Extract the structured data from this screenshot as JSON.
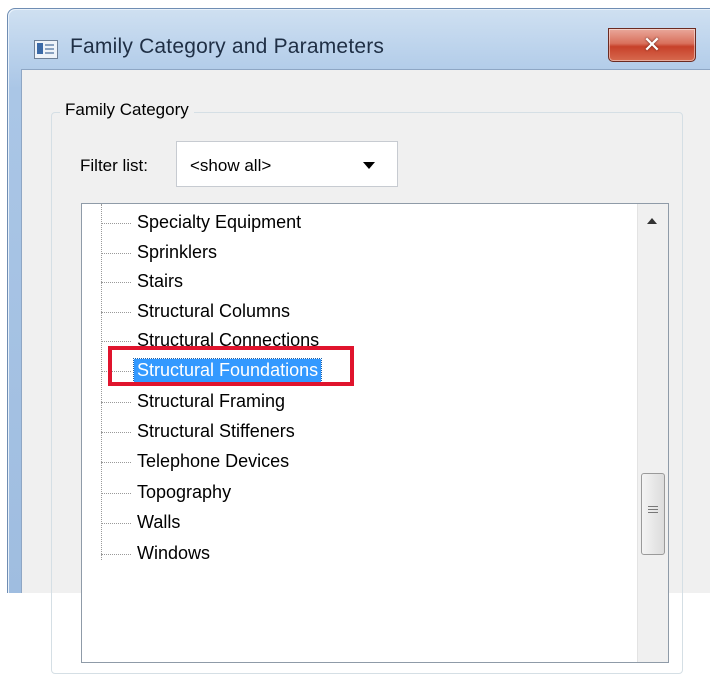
{
  "window": {
    "title": "Family Category and Parameters",
    "close_label": "✕"
  },
  "family_category": {
    "group_label": "Family Category",
    "filter": {
      "label": "Filter list:",
      "value": "<show all>"
    },
    "tree": {
      "items": [
        {
          "label": "Specialty Equipment",
          "selected": false
        },
        {
          "label": "Sprinklers",
          "selected": false
        },
        {
          "label": "Stairs",
          "selected": false
        },
        {
          "label": "Structural Columns",
          "selected": false
        },
        {
          "label": "Structural Connections",
          "selected": false
        },
        {
          "label": "Structural Foundations",
          "selected": true
        },
        {
          "label": "Structural Framing",
          "selected": false
        },
        {
          "label": "Structural Stiffeners",
          "selected": false
        },
        {
          "label": "Telephone Devices",
          "selected": false
        },
        {
          "label": "Topography",
          "selected": false
        },
        {
          "label": "Walls",
          "selected": false
        },
        {
          "label": "Windows",
          "selected": false
        }
      ]
    }
  },
  "icons": {
    "app": "family-dialog-icon",
    "close": "close-icon",
    "dropdown": "chevron-down-icon",
    "scroll_up": "scroll-up-arrow-icon",
    "thumb": "scroll-thumb-grip-icon"
  },
  "colors": {
    "selection": "#3399ff",
    "annotation": "#e0142d",
    "close_button": "#c7412a"
  }
}
